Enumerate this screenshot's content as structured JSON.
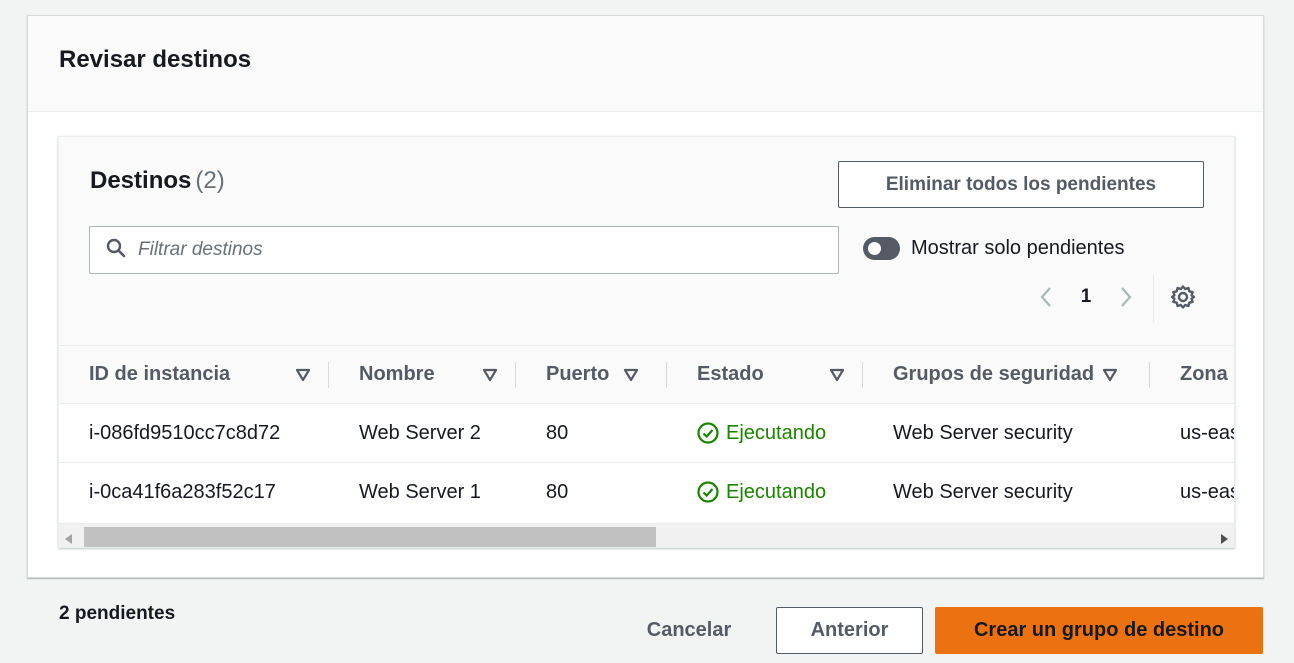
{
  "review": {
    "title": "Revisar destinos"
  },
  "targets": {
    "title": "Destinos",
    "count": "(2)",
    "remove_all_label": "Eliminar todos los pendientes",
    "search_placeholder": "Filtrar destinos",
    "search_value": "",
    "toggle_label": "Mostrar solo pendientes",
    "toggle_on": false,
    "page": "1",
    "columns": [
      "ID de instancia",
      "Nombre",
      "Puerto",
      "Estado",
      "Grupos de seguridad",
      "Zona"
    ],
    "rows": [
      {
        "id": "i-086fd9510cc7c8d72",
        "name": "Web Server 2",
        "port": "80",
        "status": "Ejecutando",
        "sg": "Web Server security",
        "zone": "us-eas"
      },
      {
        "id": "i-0ca41f6a283f52c17",
        "name": "Web Server 1",
        "port": "80",
        "status": "Ejecutando",
        "sg": "Web Server security",
        "zone": "us-eas"
      }
    ]
  },
  "footer": {
    "pending": "2 pendientes",
    "cancel": "Cancelar",
    "previous": "Anterior",
    "create": "Crear un grupo de destino"
  },
  "icons": {
    "search": "search-icon",
    "sort": "sort-down-icon",
    "status": "check-circle-icon",
    "settings": "gear-icon",
    "prev": "chevron-left-icon",
    "next": "chevron-right-icon"
  },
  "colors": {
    "primary": "#ec7211",
    "success": "#1d8102",
    "text": "#16191f",
    "secondary_text": "#545b64"
  }
}
